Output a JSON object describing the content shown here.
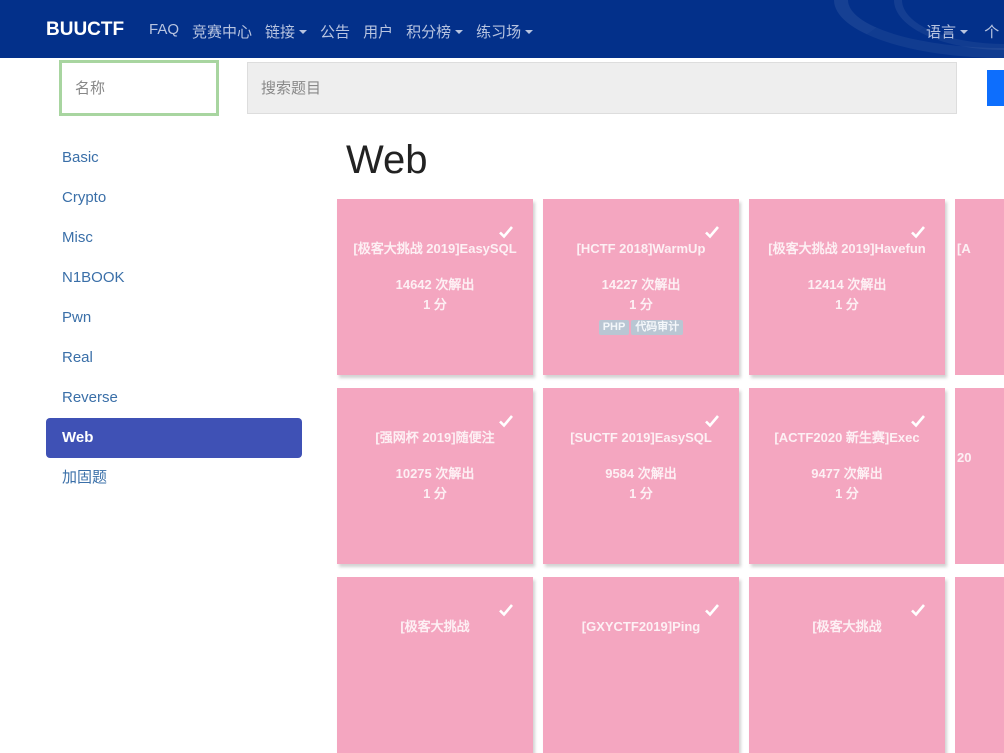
{
  "nav": {
    "brand": "BUUCTF",
    "items": [
      {
        "label": "FAQ",
        "dropdown": false
      },
      {
        "label": "竞赛中心",
        "dropdown": false
      },
      {
        "label": "链接",
        "dropdown": true
      },
      {
        "label": "公告",
        "dropdown": false
      },
      {
        "label": "用户",
        "dropdown": false
      },
      {
        "label": "积分榜",
        "dropdown": true
      },
      {
        "label": "练习场",
        "dropdown": true
      }
    ],
    "language": "语言",
    "personal": "个"
  },
  "search": {
    "name_placeholder": "名称",
    "query_placeholder": "搜索题目"
  },
  "sidebar": {
    "items": [
      "Basic",
      "Crypto",
      "Misc",
      "N1BOOK",
      "Pwn",
      "Real",
      "Reverse",
      "Web",
      "加固题"
    ],
    "active": "Web"
  },
  "page_title": "Web",
  "colors": {
    "nav": "#03308a",
    "solved_card": "#f4a6c0",
    "active": "#3f51b5"
  },
  "challenges": [
    {
      "title": "[极客大挑战 2019]EasySQL",
      "solves": "14642 次解出",
      "points": "1 分",
      "tags": [],
      "solved": true
    },
    {
      "title": "[HCTF 2018]WarmUp",
      "solves": "14227 次解出",
      "points": "1 分",
      "tags": [
        "PHP",
        "代码审计"
      ],
      "solved": true
    },
    {
      "title": "[极客大挑战 2019]Havefun",
      "solves": "12414 次解出",
      "points": "1 分",
      "tags": [],
      "solved": true
    },
    {
      "title": "[A",
      "solves": "",
      "points": "",
      "tags": [],
      "solved": true
    },
    {
      "title": "[强网杯 2019]随便注",
      "solves": "10275 次解出",
      "points": "1 分",
      "tags": [],
      "solved": true
    },
    {
      "title": "[SUCTF 2019]EasySQL",
      "solves": "9584 次解出",
      "points": "1 分",
      "tags": [],
      "solved": true
    },
    {
      "title": "[ACTF2020 新生赛]Exec",
      "solves": "9477 次解出",
      "points": "1 分",
      "tags": [],
      "solved": true
    },
    {
      "title": "20",
      "solves": "",
      "points": "",
      "tags": [],
      "solved": true
    },
    {
      "title": "[极客大挑战",
      "solves": "",
      "points": "",
      "tags": [],
      "solved": true
    },
    {
      "title": "[GXYCTF2019]Ping",
      "solves": "",
      "points": "",
      "tags": [],
      "solved": true
    },
    {
      "title": "[极客大挑战",
      "solves": "",
      "points": "",
      "tags": [],
      "solved": true
    },
    {
      "title": "",
      "solves": "",
      "points": "",
      "tags": [],
      "solved": true
    }
  ]
}
